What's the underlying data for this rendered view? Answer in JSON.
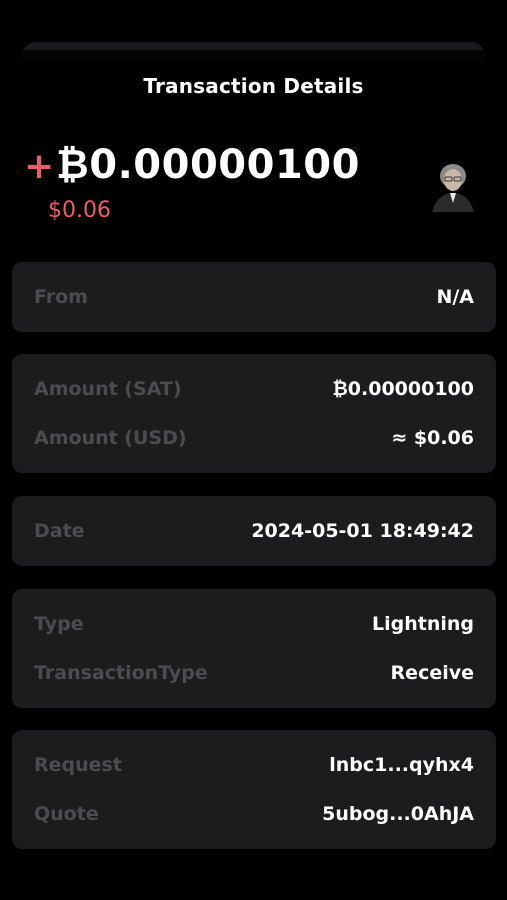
{
  "header": {
    "title": "Transaction Details"
  },
  "amount": {
    "sign": "+",
    "value": "₿0.00000100",
    "fiat": "$0.06"
  },
  "colors": {
    "accent": "#ef5b6d",
    "background": "#000000",
    "card": "#1c1c1f",
    "label": "#4b4b50"
  },
  "sections": {
    "from": {
      "label": "From",
      "value": "N/A"
    },
    "amounts": {
      "sat_label": "Amount (SAT)",
      "sat_value": "₿0.00000100",
      "usd_label": "Amount (USD)",
      "usd_value": "≈ $0.06"
    },
    "date": {
      "label": "Date",
      "value": "2024-05-01 18:49:42"
    },
    "type": {
      "type_label": "Type",
      "type_value": "Lightning",
      "tx_label": "TransactionType",
      "tx_value": "Receive"
    },
    "request": {
      "request_label": "Request",
      "request_value": "lnbc1...qyhx4",
      "quote_label": "Quote",
      "quote_value": "5ubog...0AhJA"
    }
  },
  "avatar_icon": "user-avatar-icon"
}
